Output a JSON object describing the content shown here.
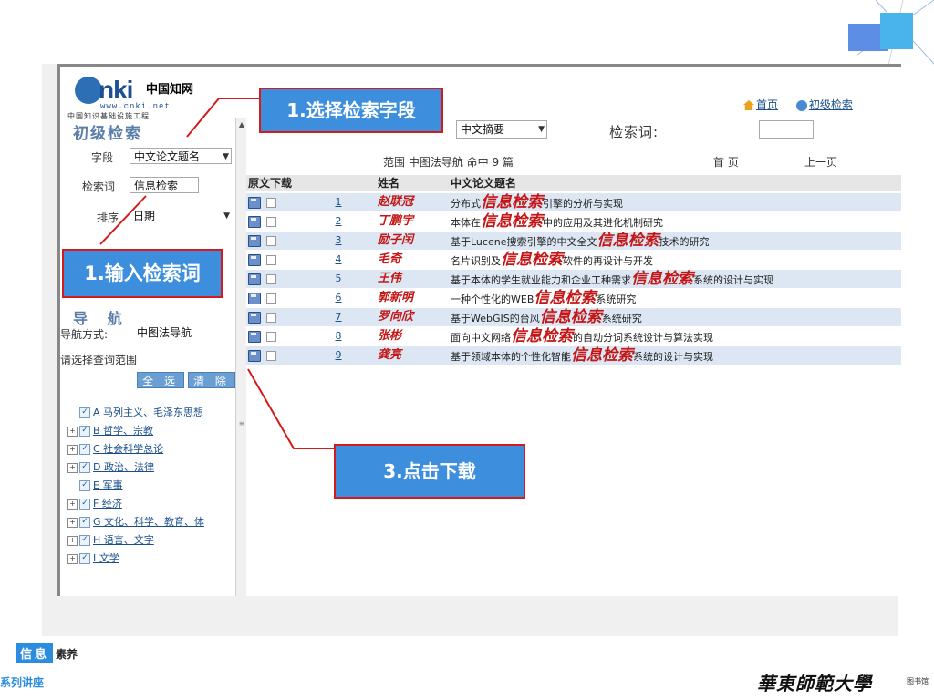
{
  "sidebar": {
    "logo_brand": "nki",
    "logo_cn": "中国知网",
    "logo_url": "www.cnki.net",
    "logo_sub": "中国知识基础设施工程",
    "title": "初级检索",
    "field_label": "字段",
    "field_value": "中文论文题名",
    "keyword_label": "检索词",
    "keyword_value": "信息检索",
    "sort_label": "排序",
    "sort_value": "日期",
    "nav_title": "导 航",
    "nav_mode_label": "导航方式:",
    "nav_mode_value": "中图法导航",
    "range_hint": "请选择查询范围",
    "select_all": "全 选",
    "clear": "清 除",
    "categories": [
      {
        "expand": "",
        "label": "A 马列主义、毛泽东思想"
      },
      {
        "expand": "+",
        "label": "B 哲学、宗教"
      },
      {
        "expand": "+",
        "label": "C 社会科学总论"
      },
      {
        "expand": "+",
        "label": "D 政治、法律"
      },
      {
        "expand": "",
        "label": "E 军事"
      },
      {
        "expand": "+",
        "label": "F 经济"
      },
      {
        "expand": "+",
        "label": "G 文化、科学、教育、体"
      },
      {
        "expand": "+",
        "label": "H 语言、文字"
      },
      {
        "expand": "+",
        "label": "I 文学"
      }
    ]
  },
  "main": {
    "home_link": "首页",
    "basic_search_link": "初级检索",
    "field_select": "中文摘要",
    "keyword_label": "检索词:",
    "range_text": "范围  中图法导航  命中 9 篇",
    "pager_first": "首 页",
    "pager_prev": "上一页",
    "columns": [
      "原文下载",
      "姓名",
      "中文论文题名"
    ],
    "rows": [
      {
        "no": "1",
        "author": "赵联冠",
        "pre": "分布式",
        "hl": "信息检索",
        "post": "引擎的分析与实现"
      },
      {
        "no": "2",
        "author": "丁鹏宇",
        "pre": "本体在",
        "hl": "信息检索",
        "post": "中的应用及其进化机制研究"
      },
      {
        "no": "3",
        "author": "励子闰",
        "pre": "基于Lucene搜索引擎的中文全文",
        "hl": "信息检索",
        "post": "技术的研究"
      },
      {
        "no": "4",
        "author": "毛奇",
        "pre": "名片识别及",
        "hl": "信息检索",
        "post": "软件的再设计与开发"
      },
      {
        "no": "5",
        "author": "王伟",
        "pre": "基于本体的学生就业能力和企业工种需求",
        "hl": "信息检索",
        "post": "系统的设计与实现"
      },
      {
        "no": "6",
        "author": "郭新明",
        "pre": "一种个性化的WEB",
        "hl": "信息检索",
        "post": "系统研究"
      },
      {
        "no": "7",
        "author": "罗向欣",
        "pre": "基于WebGIS的台风",
        "hl": "信息检索",
        "post": "系统研究"
      },
      {
        "no": "8",
        "author": "张彬",
        "pre": "面向中文网络",
        "hl": "信息检索",
        "post": "的自动分词系统设计与算法实现"
      },
      {
        "no": "9",
        "author": "龚亮",
        "pre": "基于领域本体的个性化智能",
        "hl": "信息检索",
        "post": "系统的设计与实现"
      }
    ]
  },
  "annotations": {
    "select_field": "1.选择检索字段",
    "input_keyword": "1.输入检索词",
    "click_download": "3.点击下载"
  },
  "footer": {
    "badge": "信息",
    "suffix": "素养",
    "series": "系列讲座",
    "university": "華東師範大學",
    "library": "图书馆"
  },
  "colors": {
    "callout_fill": "#3d8fde",
    "callout_border": "#d41a1a",
    "highlight_red": "#c41616",
    "row_alt": "#dce7f3"
  }
}
